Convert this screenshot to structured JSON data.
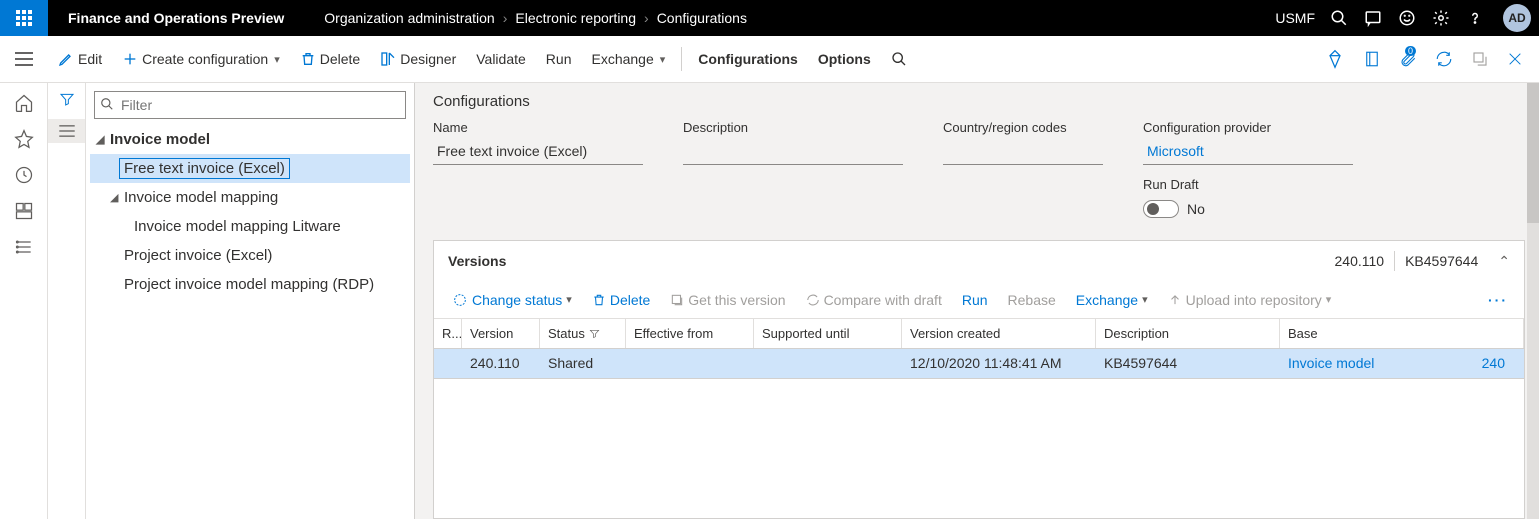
{
  "topbar": {
    "app_title": "Finance and Operations Preview",
    "breadcrumbs": [
      "Organization administration",
      "Electronic reporting",
      "Configurations"
    ],
    "company": "USMF",
    "avatar": "AD"
  },
  "actionbar": {
    "edit": "Edit",
    "create": "Create configuration",
    "delete": "Delete",
    "designer": "Designer",
    "validate": "Validate",
    "run": "Run",
    "exchange": "Exchange",
    "configurations": "Configurations",
    "options": "Options",
    "badge": "0"
  },
  "tree": {
    "filter_placeholder": "Filter",
    "items": [
      {
        "label": "Invoice model",
        "level": 1,
        "expanded": true
      },
      {
        "label": "Free text invoice (Excel)",
        "level": 2,
        "selected": true
      },
      {
        "label": "Invoice model mapping",
        "level": 2,
        "expanded": true
      },
      {
        "label": "Invoice model mapping Litware",
        "level": 3
      },
      {
        "label": "Project invoice (Excel)",
        "level": 2
      },
      {
        "label": "Project invoice model mapping (RDP)",
        "level": 2
      }
    ]
  },
  "main": {
    "section_title": "Configurations",
    "fields": {
      "name_label": "Name",
      "name_value": "Free text invoice (Excel)",
      "desc_label": "Description",
      "desc_value": "",
      "country_label": "Country/region codes",
      "country_value": "",
      "provider_label": "Configuration provider",
      "provider_value": "Microsoft",
      "rundraft_label": "Run Draft",
      "rundraft_value": "No"
    }
  },
  "versions": {
    "title": "Versions",
    "meta_version": "240.110",
    "meta_desc": "KB4597644",
    "toolbar": {
      "change_status": "Change status",
      "delete": "Delete",
      "get_version": "Get this version",
      "compare": "Compare with draft",
      "run": "Run",
      "rebase": "Rebase",
      "exchange": "Exchange",
      "upload": "Upload into repository"
    },
    "columns": {
      "r": "R...",
      "version": "Version",
      "status": "Status",
      "effective": "Effective from",
      "supported": "Supported until",
      "created": "Version created",
      "desc": "Description",
      "base": "Base"
    },
    "rows": [
      {
        "version": "240.110",
        "status": "Shared",
        "effective": "",
        "supported": "",
        "created": "12/10/2020 11:48:41 AM",
        "desc": "KB4597644",
        "base_name": "Invoice model",
        "base_ver": "240"
      }
    ]
  }
}
